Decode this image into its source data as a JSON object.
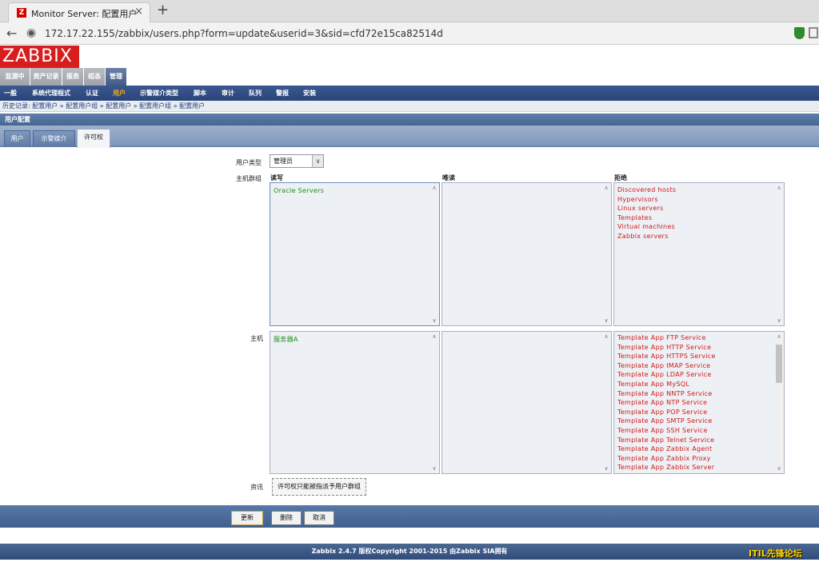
{
  "browser": {
    "tab_title": "Monitor Server: 配置用户",
    "tab_close": "×",
    "new_tab": "+",
    "favicon": "Z",
    "url": "172.17.22.155/zabbix/users.php?form=update&userid=3&sid=cfd72e15ca82514d"
  },
  "logo": "ZABBIX",
  "main_menu": [
    "监测中",
    "资产记录",
    "报表",
    "组态",
    "管理"
  ],
  "sub_menu": [
    "一般",
    "系统代理程式",
    "认证",
    "用户",
    "示警媒介类型",
    "脚本",
    "审计",
    "队列",
    "警报",
    "安装"
  ],
  "history": "历史记录:  配置用户  »  配置用户组  »  配置用户  »  配置用户组  »  配置用户",
  "page_title": "用户配置",
  "form_tabs": [
    "用户",
    "示警媒介",
    "许可权"
  ],
  "user_type": {
    "label": "用户类型",
    "value": "管理员"
  },
  "host_groups": {
    "label": "主机群组"
  },
  "columns": {
    "rw": "读写",
    "ro": "唯读",
    "deny": "拒绝"
  },
  "hostgroup_rw": [
    "Oracle Servers"
  ],
  "hostgroup_ro": [],
  "hostgroup_deny": [
    "Discovered hosts",
    "Hypervisors",
    "Linux servers",
    "Templates",
    "Virtual machines",
    "Zabbix servers"
  ],
  "hosts": {
    "label": "主机"
  },
  "host_rw": [
    "服务器A"
  ],
  "host_ro": [],
  "host_deny": [
    "Template App FTP Service",
    "Template App HTTP Service",
    "Template App HTTPS Service",
    "Template App IMAP Service",
    "Template App LDAP Service",
    "Template App MySQL",
    "Template App NNTP Service",
    "Template App NTP Service",
    "Template App POP Service",
    "Template App SMTP Service",
    "Template App SSH Service",
    "Template App Telnet Service",
    "Template App Zabbix Agent",
    "Template App Zabbix Proxy",
    "Template App Zabbix Server"
  ],
  "info": {
    "label": "资讯",
    "text": "许可权只能被指派予用户群组"
  },
  "buttons": {
    "update": "更新",
    "delete": "删除",
    "cancel": "取消"
  },
  "footer": "Zabbix 2.4.7 版权Copyright 2001-2015 由Zabbix SIA拥有",
  "watermark": "ITIL先锋论坛"
}
